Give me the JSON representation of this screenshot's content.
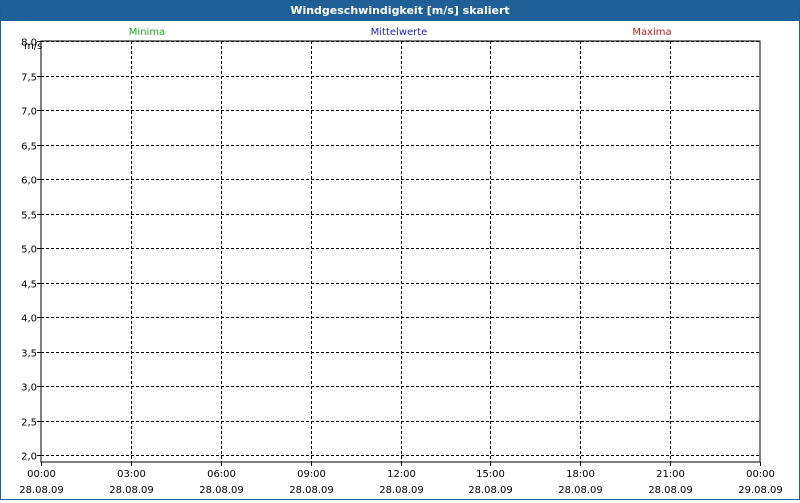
{
  "window": {
    "title": "Windgeschwindigkeit [m/s] skaliert"
  },
  "chart_data": {
    "type": "line",
    "title": "Windgeschwindigkeit [m/s] skaliert",
    "ylabel": "m/s",
    "xlabel": "",
    "ylim": [
      1.9,
      8.0
    ],
    "yticks": [
      "8,0",
      "7,5",
      "7,0",
      "6,5",
      "6,0",
      "5,5",
      "5,0",
      "4,5",
      "4,0",
      "3,5",
      "3,0",
      "2,5",
      "2,0"
    ],
    "yticks_values": [
      8.0,
      7.5,
      7.0,
      6.5,
      6.0,
      5.5,
      5.0,
      4.5,
      4.0,
      3.5,
      3.0,
      2.5,
      2.0
    ],
    "xticks": [
      {
        "time": "00:00",
        "date": "28.08.09"
      },
      {
        "time": "03:00",
        "date": "28.08.09"
      },
      {
        "time": "06:00",
        "date": "28.08.09"
      },
      {
        "time": "09:00",
        "date": "28.08.09"
      },
      {
        "time": "12:00",
        "date": "28.08.09"
      },
      {
        "time": "15:00",
        "date": "28.08.09"
      },
      {
        "time": "18:00",
        "date": "28.08.09"
      },
      {
        "time": "21:00",
        "date": "28.08.09"
      },
      {
        "time": "00:00",
        "date": "29.08.09"
      }
    ],
    "grid": true,
    "legend_placement": "top",
    "series": [
      {
        "name": "Minima",
        "color": "#22aa22",
        "values": []
      },
      {
        "name": "Mittelwerte",
        "color": "#2222bb",
        "values": []
      },
      {
        "name": "Maxima",
        "color": "#bb2222",
        "values": []
      }
    ]
  }
}
